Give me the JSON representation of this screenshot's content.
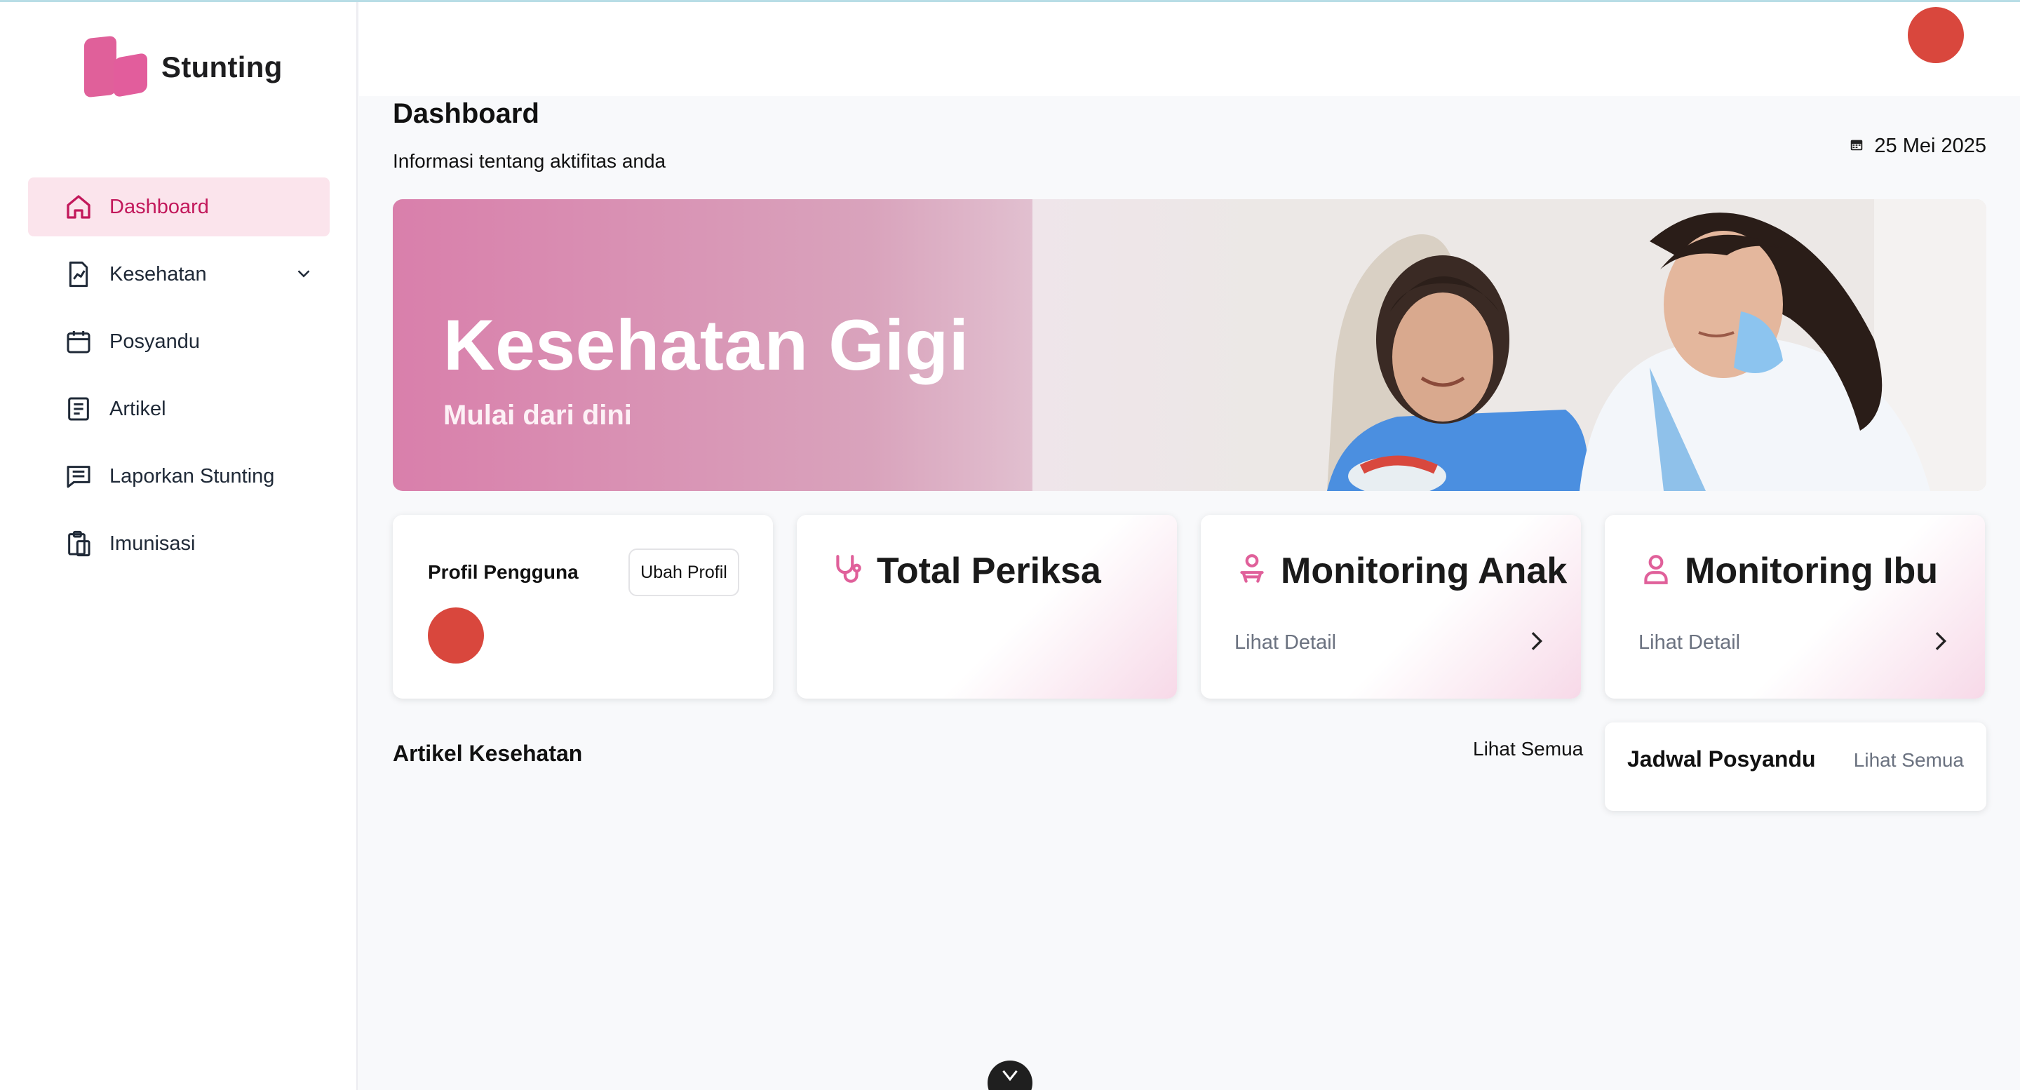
{
  "app": {
    "name": "Stunting"
  },
  "sidebar": {
    "items": [
      {
        "label": "Dashboard",
        "icon": "home-icon",
        "active": true
      },
      {
        "label": "Kesehatan",
        "icon": "chart-document-icon",
        "has_dropdown": true
      },
      {
        "label": "Posyandu",
        "icon": "calendar-icon"
      },
      {
        "label": "Artikel",
        "icon": "article-icon"
      },
      {
        "label": "Laporkan Stunting",
        "icon": "message-icon"
      },
      {
        "label": "Imunisasi",
        "icon": "clipboard-icon"
      }
    ]
  },
  "header": {
    "avatar_color": "#d9473d"
  },
  "page": {
    "title": "Dashboard",
    "subtitle": "Informasi tentang aktifitas anda",
    "date": "25 Mei 2025"
  },
  "banner": {
    "title": "Kesehatan Gigi",
    "subtitle": "Mulai dari dini"
  },
  "cards": {
    "profile": {
      "title": "Profil Pengguna",
      "button": "Ubah Profil"
    },
    "total": {
      "title": "Total Periksa",
      "icon": "stethoscope-icon"
    },
    "anak": {
      "title": "Monitoring Anak",
      "link": "Lihat Detail",
      "icon": "child-icon"
    },
    "ibu": {
      "title": "Monitoring Ibu",
      "link": "Lihat Detail",
      "icon": "person-icon"
    }
  },
  "articles": {
    "title": "Artikel Kesehatan",
    "link": "Lihat Semua"
  },
  "jadwal": {
    "title": "Jadwal Posyandu",
    "link": "Lihat Semua"
  },
  "colors": {
    "accent": "#e0609a",
    "active_bg": "#fbe4ec",
    "active_text": "#c2185b"
  }
}
